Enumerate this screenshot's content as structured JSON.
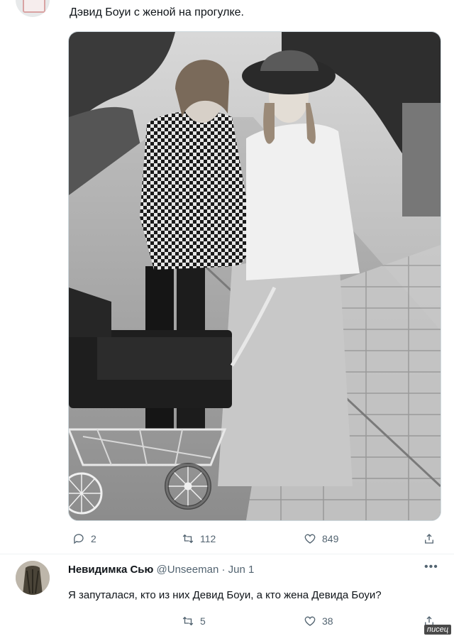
{
  "tweet": {
    "text": "Дэвид Боуи с женой на прогулке.",
    "actions": {
      "replies": "2",
      "retweets": "112",
      "likes": "849"
    }
  },
  "reply": {
    "display_name": "Невидимка Сью",
    "handle_and_date": "@Unseeman · Jun 1",
    "text": "Я запуталася, кто из них Девид Боуи, а кто жена Девида Боуи?",
    "actions": {
      "retweets": "5",
      "likes": "38"
    }
  },
  "watermark": "писец",
  "icons": [
    "reply-icon",
    "retweet-icon",
    "like-icon",
    "share-icon",
    "more-icon"
  ],
  "colors": {
    "text": "#0f1419",
    "secondary": "#536471",
    "border": "#cfd9de"
  }
}
